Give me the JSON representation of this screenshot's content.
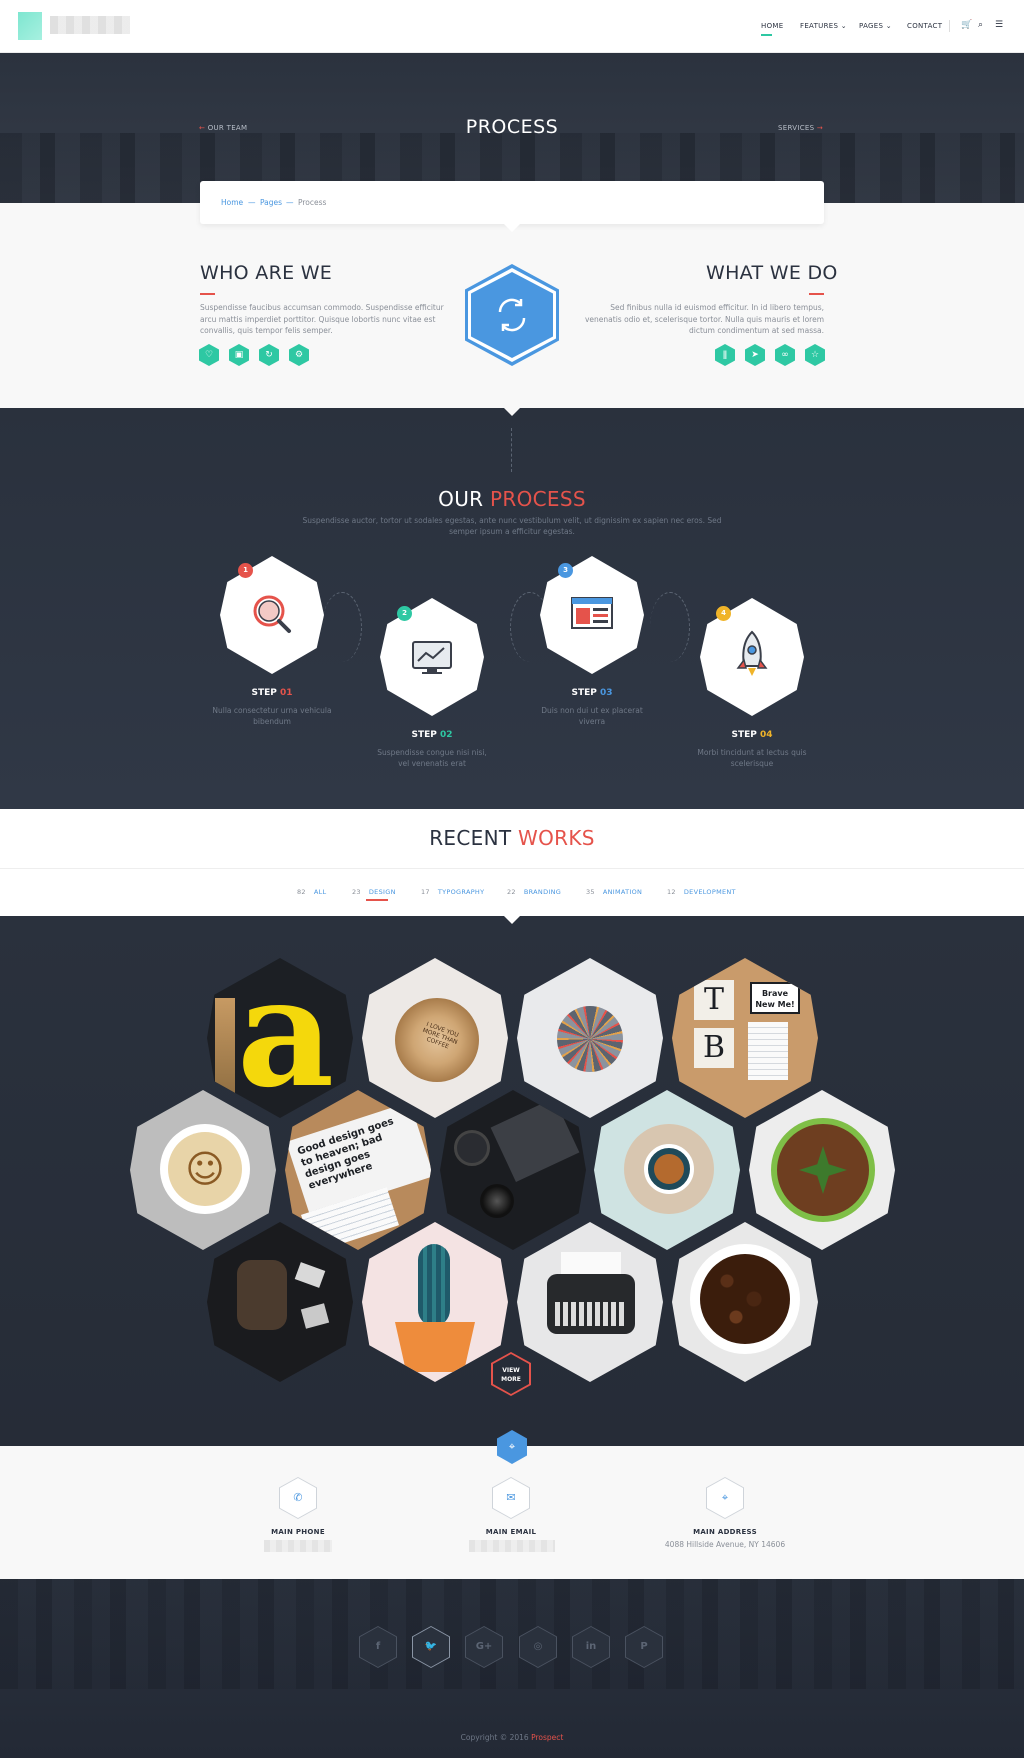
{
  "nav": {
    "items": [
      "HOME",
      "FEATURES ⌄",
      "PAGES ⌄",
      "CONTACT"
    ]
  },
  "hero": {
    "title": "PROCESS",
    "prev": "OUR TEAM",
    "next": "SERVICES"
  },
  "breadcrumb": {
    "home": "Home",
    "sep": "—",
    "pages": "Pages",
    "current": "Process"
  },
  "about": {
    "left_title": "WHO ARE WE",
    "left_text": "Suspendisse faucibus accumsan commodo. Suspendisse efficitur arcu mattis imperdiet porttitor. Quisque lobortis nunc vitae est convallis, quis tempor felis semper.",
    "right_title": "WHAT WE DO",
    "right_text": "Sed finibus nulla id euismod efficitur. In id libero tempus, venenatis odio et, scelerisque tortor. Nulla quis mauris et lorem dictum condimentum at sed massa."
  },
  "process": {
    "title_a": "OUR",
    "title_b": "PROCESS",
    "subtitle": "Suspendisse auctor, tortor ut sodales egestas, ante nunc vestibulum velit, ut dignissim ex sapien nec eros. Sed semper ipsum a efficitur egestas.",
    "steps": [
      {
        "badge": "1",
        "label": "STEP",
        "num": "01",
        "text": "Nulla consectetur urna vehicula bibendum",
        "color": "#e5534b"
      },
      {
        "badge": "2",
        "label": "STEP",
        "num": "02",
        "text": "Suspendisse congue nisi nisi, vel venenatis erat",
        "color": "#2ec8a3"
      },
      {
        "badge": "3",
        "label": "STEP",
        "num": "03",
        "text": "Duis non dui ut ex placerat viverra",
        "color": "#4a97e0"
      },
      {
        "badge": "4",
        "label": "STEP",
        "num": "04",
        "text": "Morbi tincidunt at lectus quis scelerisque",
        "color": "#f0b429"
      }
    ]
  },
  "works": {
    "title_a": "RECENT",
    "title_b": "WORKS",
    "filters": [
      {
        "count": "82",
        "label": "ALL"
      },
      {
        "count": "23",
        "label": "DESIGN"
      },
      {
        "count": "17",
        "label": "TYPOGRAPHY"
      },
      {
        "count": "22",
        "label": "BRANDING"
      },
      {
        "count": "35",
        "label": "ANIMATION"
      },
      {
        "count": "12",
        "label": "DEVELOPMENT"
      }
    ],
    "view_more": "VIEW MORE",
    "thumb_text_a": "a",
    "thumb_text_wood": "I LOVE YOU MORE THAN COFFEE",
    "thumb_text_bubble": "Brave New Me!",
    "thumb_text_card": "Good design goes to heaven; bad design goes everywhere"
  },
  "contact": {
    "phone_label": "MAIN PHONE",
    "email_label": "MAIN EMAIL",
    "address_label": "MAIN ADDRESS",
    "address_value": "4088 Hillside Avenue, NY 14606"
  },
  "social": [
    "f",
    "🐦",
    "G+",
    "◎",
    "in",
    "P"
  ],
  "footer": {
    "copy": "Copyright © 2016",
    "brand": "Prospect"
  },
  "colors": {
    "accent_red": "#e5534b",
    "accent_blue": "#4a97e0",
    "accent_green": "#2ec8a3",
    "dark": "#2b323e"
  }
}
